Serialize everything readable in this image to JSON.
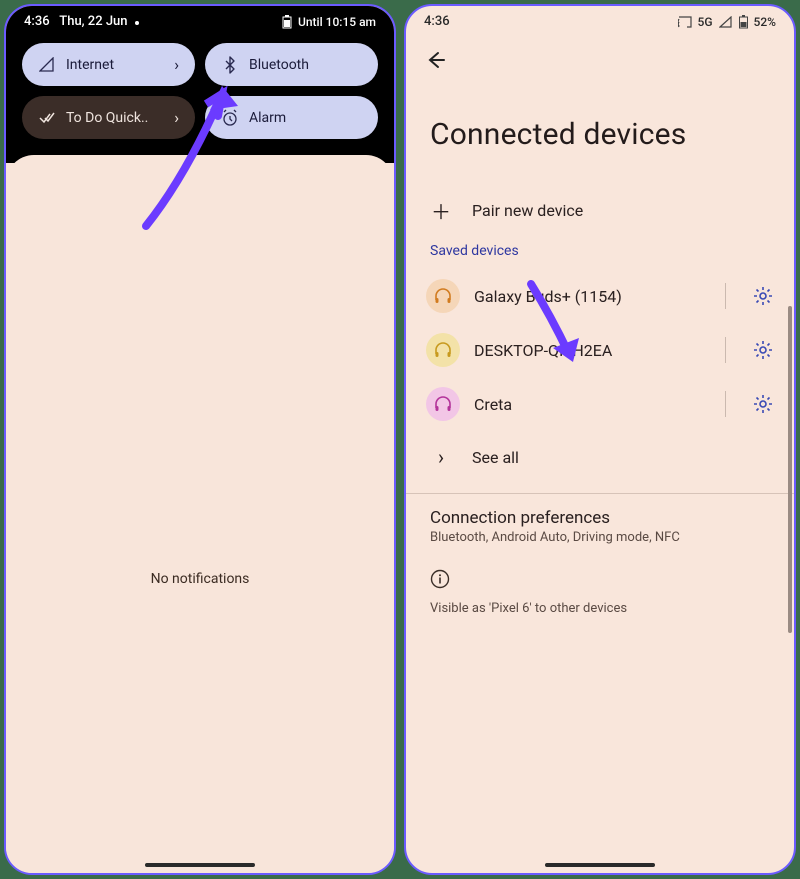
{
  "left": {
    "status": {
      "time": "4:36",
      "date": "Thu, 22 Jun",
      "alarm_text": "Until 10:15 am"
    },
    "tiles": {
      "internet": "Internet",
      "bluetooth": "Bluetooth",
      "todo": "To Do Quick..",
      "alarm": "Alarm"
    },
    "no_notifications": "No notifications"
  },
  "right": {
    "status": {
      "time": "4:36",
      "network": "5G",
      "battery": "52%"
    },
    "title": "Connected devices",
    "pair_new": "Pair new device",
    "saved_label": "Saved devices",
    "devices": {
      "d0": "Galaxy Buds+ (1154)",
      "d1": "DESKTOP-QI6H2EA",
      "d2": "Creta"
    },
    "see_all": "See all",
    "pref_title": "Connection preferences",
    "pref_sub": "Bluetooth, Android Auto, Driving mode, NFC",
    "visible_as": "Visible as 'Pixel 6' to other devices"
  }
}
